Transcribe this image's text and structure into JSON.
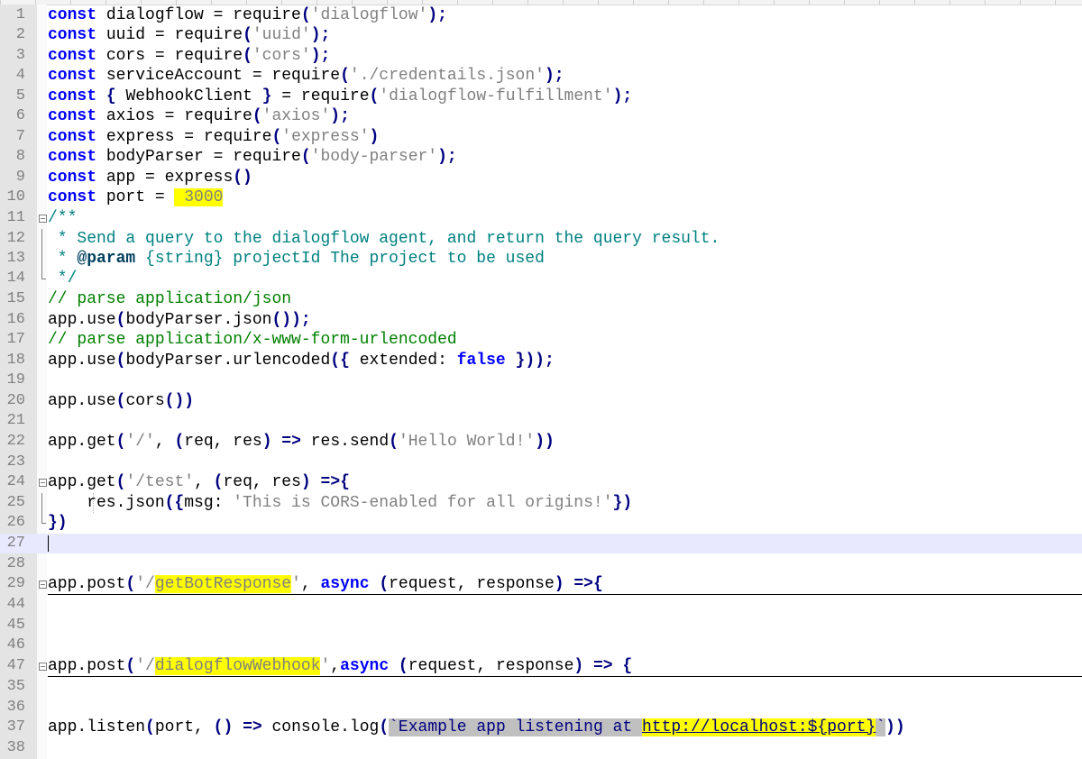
{
  "line_numbers": [
    "1",
    "2",
    "3",
    "4",
    "5",
    "6",
    "7",
    "8",
    "9",
    "10",
    "11",
    "12",
    "13",
    "14",
    "15",
    "16",
    "17",
    "18",
    "19",
    "20",
    "21",
    "22",
    "23",
    "24",
    "25",
    "26",
    "27",
    "28",
    "29",
    "44",
    "45",
    "46",
    "47",
    "35",
    "36",
    "37",
    "38"
  ],
  "kw": {
    "const": "const",
    "false": "false",
    "async": "async"
  },
  "l1": {
    "a": " dialogflow = ",
    "b": "require",
    "c": "(",
    "s": "'dialogflow'",
    "d": ");"
  },
  "l2": {
    "a": " uuid = ",
    "b": "require",
    "c": "(",
    "s": "'uuid'",
    "d": ");"
  },
  "l3": {
    "a": " cors = ",
    "b": "require",
    "c": "(",
    "s": "'cors'",
    "d": ");"
  },
  "l4": {
    "a": " serviceAccount = ",
    "b": "require",
    "c": "(",
    "s": "'./credentails.json'",
    "d": ");"
  },
  "l5": {
    "a": " ",
    "b": "{",
    "c": " WebhookClient ",
    "d": "}",
    "e": " = ",
    "f": "require",
    "g": "(",
    "s": "'dialogflow-fulfillment'",
    "h": ");"
  },
  "l6": {
    "a": " axios = ",
    "b": "require",
    "c": "(",
    "s": "'axios'",
    "d": ");"
  },
  "l7": {
    "a": " express = ",
    "b": "require",
    "c": "(",
    "s": "'express'",
    "d": ")"
  },
  "l8": {
    "a": " bodyParser = ",
    "b": "require",
    "c": "(",
    "s": "'body-parser'",
    "d": ");"
  },
  "l9": {
    "a": " app = express",
    "b": "()"
  },
  "l10": {
    "a": " port = ",
    "s": " 3000"
  },
  "l11": {
    "c": "/**"
  },
  "l12": {
    "c": " * Send a query to the dialogflow agent, and return the query result."
  },
  "l13": {
    "a": " * ",
    "tag": "@param",
    "b": " {string} projectId The project to be used"
  },
  "l14": {
    "c": " */"
  },
  "l15": {
    "c": "// parse application/json"
  },
  "l16": {
    "a": "app.use",
    "b": "(",
    "c": "bodyParser.json",
    "d": "());"
  },
  "l17": {
    "c": "// parse application/x-www-form-urlencoded"
  },
  "l18": {
    "a": "app.use",
    "b": "(",
    "c": "bodyParser.urlencoded",
    "d": "({",
    "e": " extended: ",
    "f": " }));"
  },
  "l20": {
    "a": "app.use",
    "b": "(",
    "c": "cors",
    "d": "())"
  },
  "l22": {
    "a": "app.get",
    "b": "(",
    "s": "'/'",
    "c": ", ",
    "d": "(",
    "e": "req, res",
    "f": ")",
    "g": " => ",
    "h": "res.send",
    "i": "(",
    "s2": "'Hello World!'",
    "j": "))"
  },
  "l24": {
    "a": "app.get",
    "b": "(",
    "s": "'/test'",
    "c": ", ",
    "d": "(",
    "e": "req, res",
    "f": ")",
    "g": " =>{"
  },
  "l25": {
    "a": "    res.json",
    "b": "({",
    "c": "msg: ",
    "s": "'This is CORS-enabled for all origins!'",
    "d": "})"
  },
  "l26": {
    "a": "})"
  },
  "l29": {
    "a": "app.post",
    "b": "(",
    "s1": "'/",
    "s2": "getBotResponse",
    "s3": "'",
    "c": ", ",
    "d": " (",
    "e": "request, response",
    "f": ")",
    "g": " =>{"
  },
  "l47": {
    "a": "app.post",
    "b": "(",
    "s1": "'/",
    "s2": "dialogflowWebhook",
    "s3": "'",
    "c": ",",
    "d": " (",
    "e": "request, response",
    "f": ")",
    "g": " => {"
  },
  "l37": {
    "a": "app.listen",
    "b": "(",
    "c": "port, ",
    "d": "()",
    "e": " => ",
    "f": "console.log",
    "g": "(",
    "t1": "`Example app listening at ",
    "t2": "http://localhost:${port}",
    "t3": "`",
    "h": "))"
  }
}
